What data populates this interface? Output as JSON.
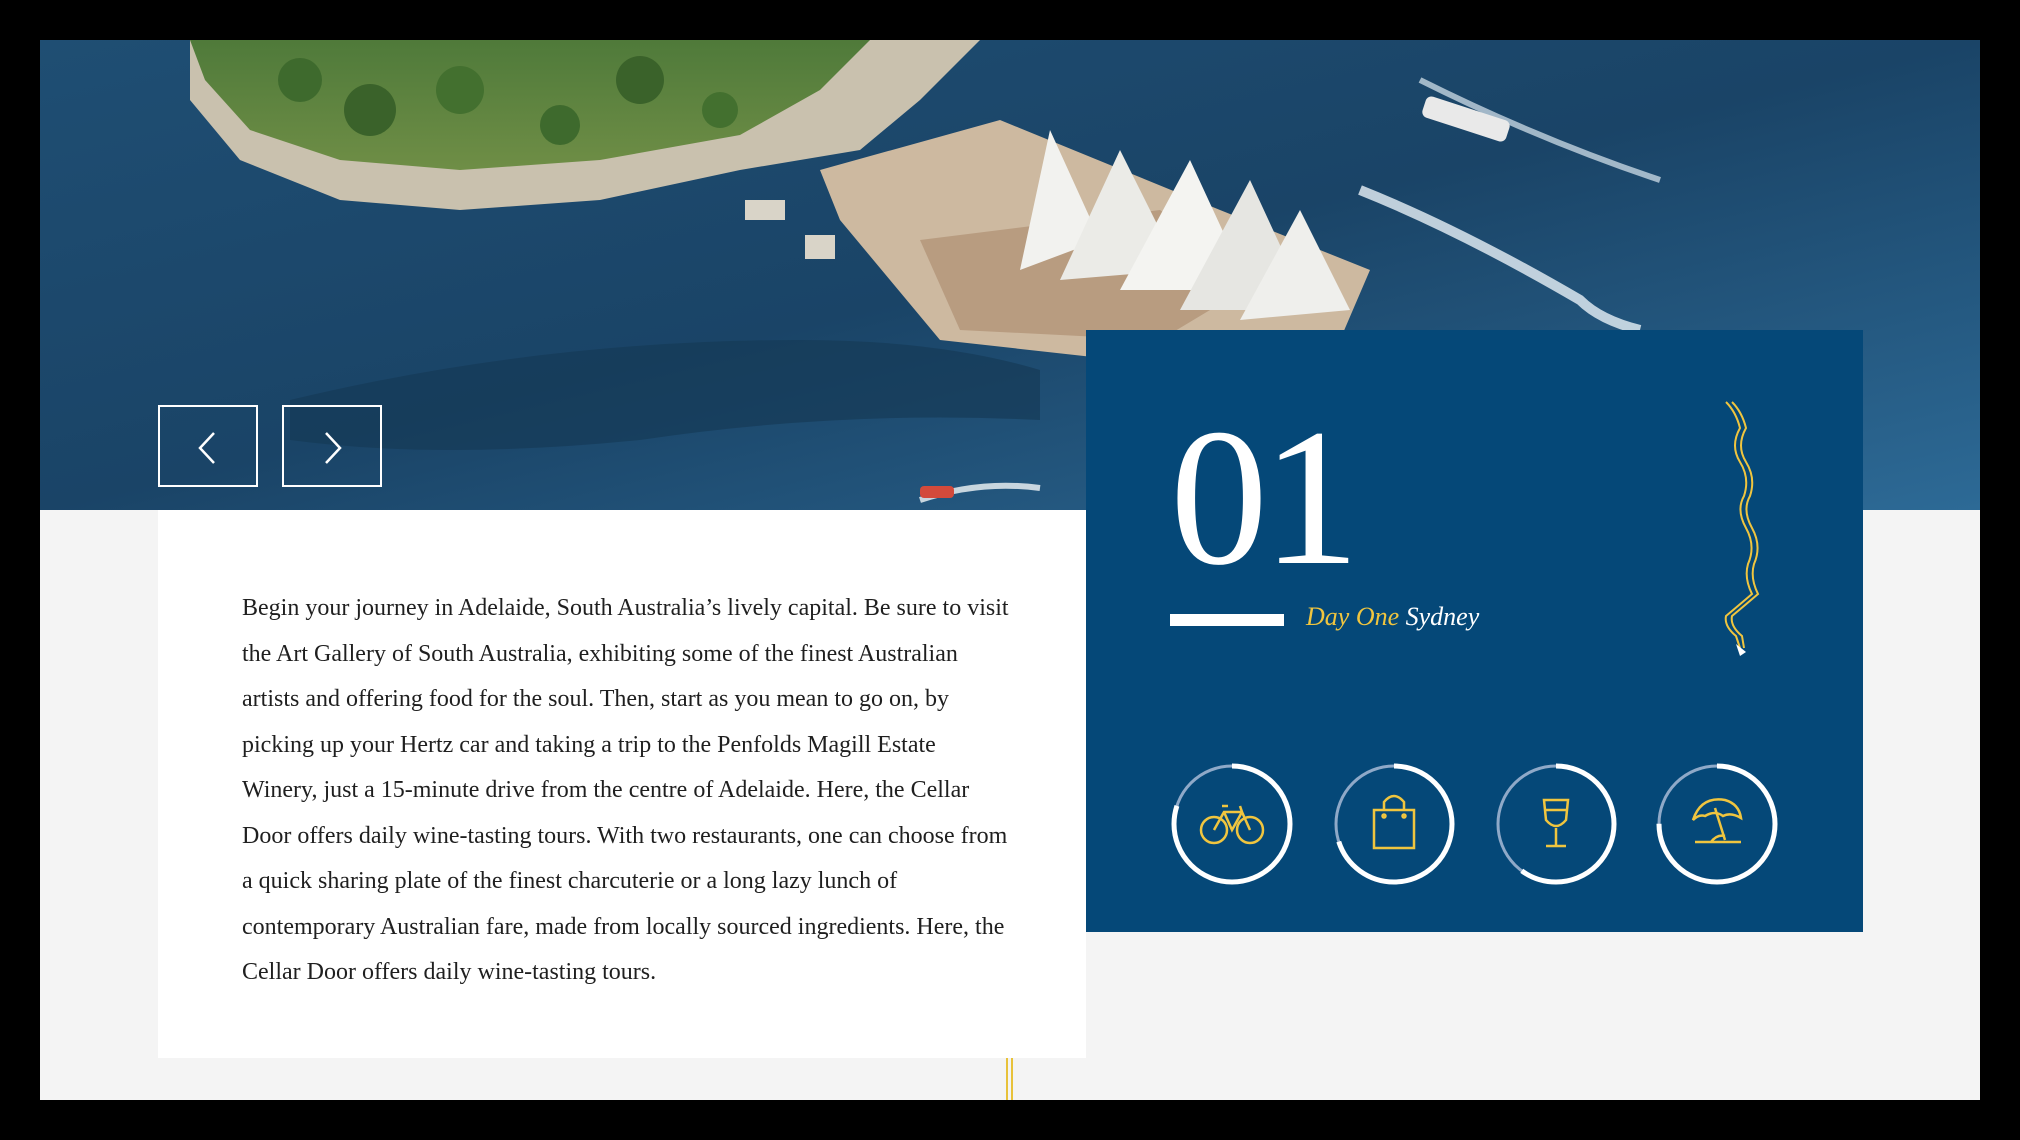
{
  "hero": {
    "scene": "aerial-photo-sydney-opera-house"
  },
  "slider": {
    "prev_icon": "chevron-left-icon",
    "next_icon": "chevron-right-icon"
  },
  "article": {
    "body": "Begin your journey in Adelaide, South Australia’s lively capital. Be sure to visit the Art Gallery of South Australia, exhibiting some of the finest Australian artists and offering food for the soul. Then, start as you mean to go on, by picking up your Hertz car and taking a trip to the Penfolds Magill Estate Winery, just a 15-minute drive from the centre of Adelaide. Here, the Cellar Door offers daily wine-tasting tours. With two restaurants, one can choose from a quick sharing plate of the finest charcuterie or a long lazy lunch of contemporary Australian fare, made from locally sourced ingredients. Here, the Cellar Door offers daily wine-tasting tours."
  },
  "day": {
    "number": "01",
    "label_day": "Day One",
    "label_city": "Sydney"
  },
  "activities": [
    {
      "icon": "bicycle-icon",
      "progress": 0.8
    },
    {
      "icon": "shopping-bag-icon",
      "progress": 0.7
    },
    {
      "icon": "wine-glass-icon",
      "progress": 0.6
    },
    {
      "icon": "beach-umbrella-icon",
      "progress": 0.75
    }
  ],
  "colors": {
    "panel_blue": "#054878",
    "accent_gold": "#f0c53f",
    "ring_white": "#ffffff",
    "ring_track": "#8fa9c8"
  }
}
